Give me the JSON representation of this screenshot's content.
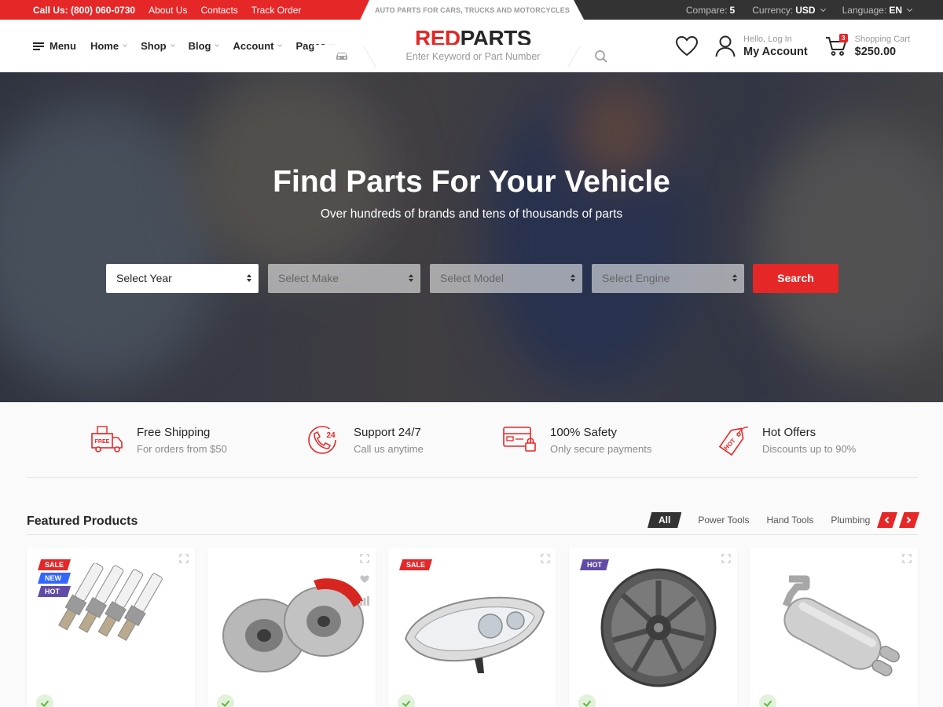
{
  "topbar": {
    "phone": "Call Us: (800) 060-0730",
    "links": [
      "About Us",
      "Contacts",
      "Track Order"
    ],
    "tagline": "AUTO PARTS FOR CARS, TRUCKS AND MOTORCYCLES",
    "compare_label": "Compare:",
    "compare_value": "5",
    "currency_label": "Currency:",
    "currency_value": "USD",
    "language_label": "Language:",
    "language_value": "EN"
  },
  "header": {
    "menu_label": "Menu",
    "nav": [
      "Home",
      "Shop",
      "Blog",
      "Account",
      "Pages"
    ],
    "logo_red": "RED",
    "logo_dark": "PARTS",
    "search_placeholder": "Enter Keyword or Part Number",
    "account_small": "Hello, Log In",
    "account_big": "My Account",
    "cart_small": "Shopping Cart",
    "cart_total": "$250.00",
    "cart_count": "3"
  },
  "hero": {
    "title": "Find Parts For Your Vehicle",
    "subtitle": "Over hundreds of brands and tens of thousands of parts",
    "selects": [
      "Select Year",
      "Select Make",
      "Select Model",
      "Select Engine"
    ],
    "search_button": "Search"
  },
  "features": [
    {
      "title": "Free Shipping",
      "desc": "For orders from $50",
      "icon": "free-shipping-truck-icon"
    },
    {
      "title": "Support 24/7",
      "desc": "Call us anytime",
      "icon": "support-24-icon"
    },
    {
      "title": "100% Safety",
      "desc": "Only secure payments",
      "icon": "secure-card-icon"
    },
    {
      "title": "Hot Offers",
      "desc": "Discounts up to 90%",
      "icon": "hot-tag-icon"
    }
  ],
  "featured": {
    "title": "Featured Products",
    "tabs": [
      "All",
      "Power Tools",
      "Hand Tools",
      "Plumbing"
    ],
    "products": [
      {
        "image": "spark-plugs",
        "badges": [
          "SALE",
          "NEW",
          "HOT"
        ]
      },
      {
        "image": "brake-discs",
        "badges": []
      },
      {
        "image": "headlight",
        "badges": [
          "SALE"
        ]
      },
      {
        "image": "wheel-rim",
        "badges": [
          "HOT"
        ]
      },
      {
        "image": "exhaust-muffler",
        "badges": []
      }
    ]
  },
  "colors": {
    "brand_red": "#e52727",
    "dark": "#333333",
    "badge_sale": "#e52727",
    "badge_new": "#3366ff",
    "badge_hot": "#614ba6",
    "in_stock_green": "#5bb73b"
  }
}
